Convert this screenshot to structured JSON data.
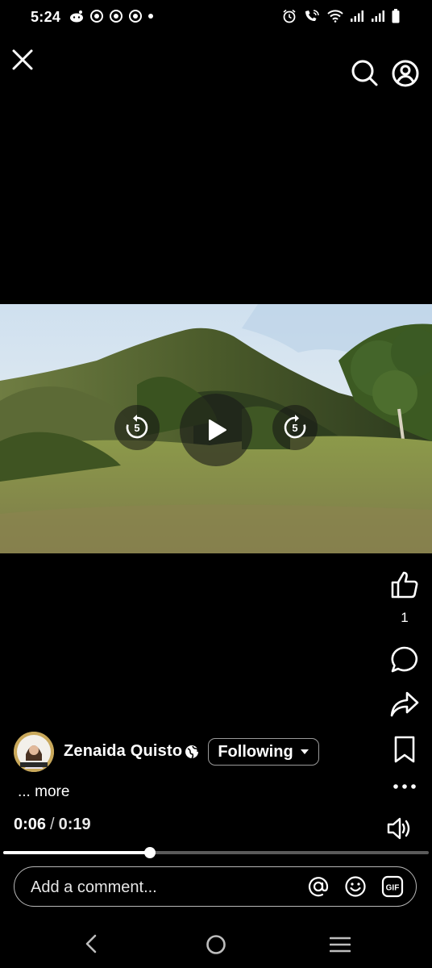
{
  "status_bar": {
    "time": "5:24"
  },
  "header": {
    "close_icon": "close-icon",
    "search_icon": "search-icon",
    "profile_icon": "profile-icon"
  },
  "video": {
    "rewind_label": "5",
    "forward_label": "5",
    "progress_fraction": 0.345
  },
  "actions": {
    "like_count": "1"
  },
  "post": {
    "author": "Zenaida Quisto",
    "follow_label": "Following",
    "more_label": "... more",
    "current_time": "0:06",
    "separator": "/",
    "total_time": "0:19"
  },
  "comment": {
    "placeholder": "Add a comment...",
    "gif_label": "GIF"
  },
  "colors": {
    "background": "#000000",
    "accent": "#ffffff"
  }
}
